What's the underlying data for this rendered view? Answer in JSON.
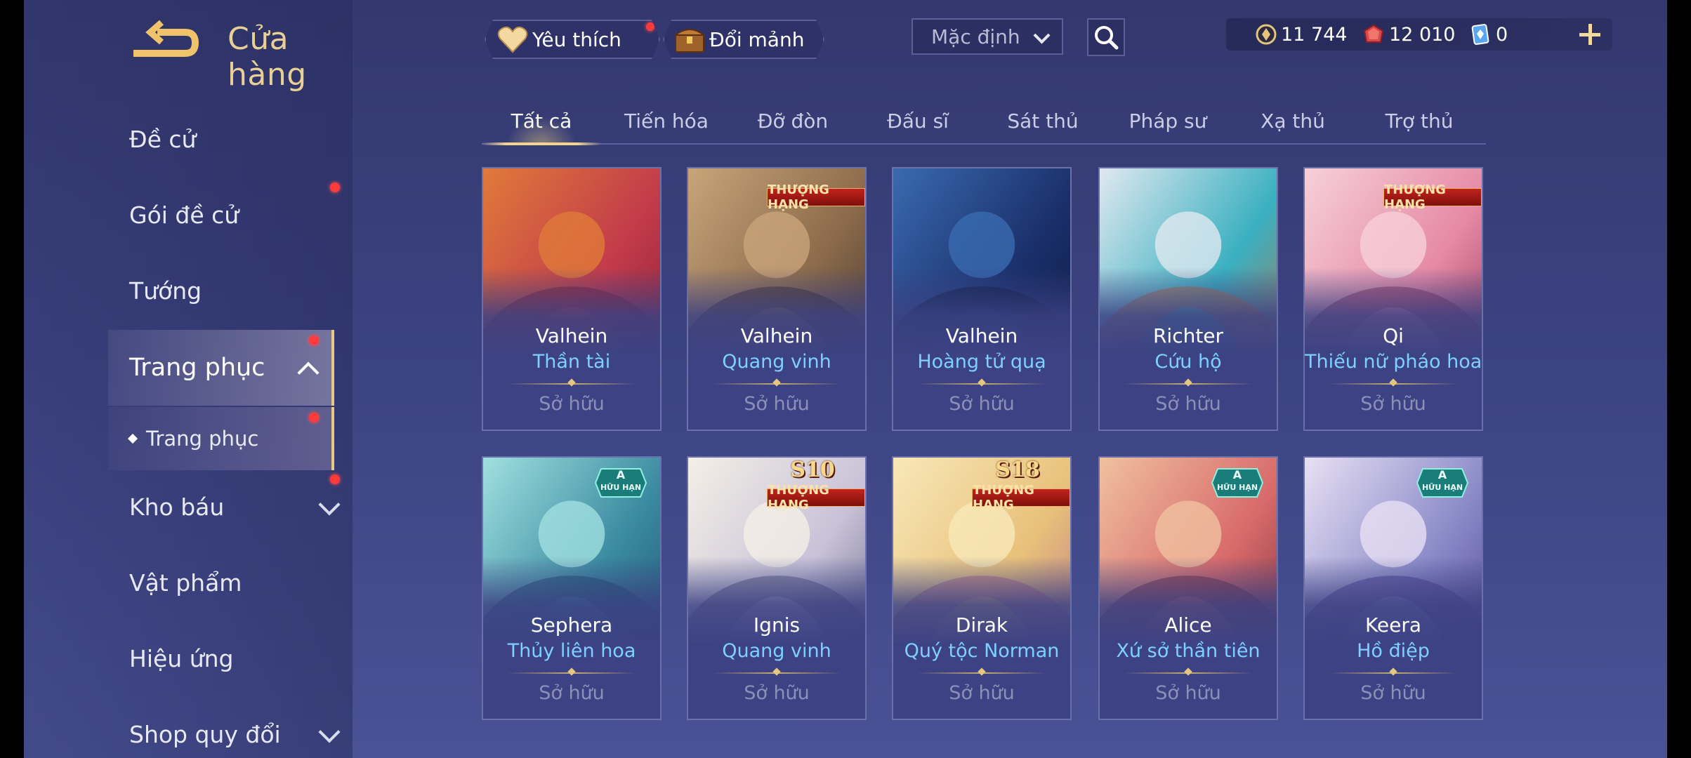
{
  "header": {
    "title": "Cửa hàng",
    "favorites_label": "Yêu thích",
    "exchange_label": "Đổi mảnh",
    "sort_value": "Mặc định"
  },
  "currency": {
    "gold": "11 744",
    "vouchers": "12 010",
    "diamonds": "0"
  },
  "sidebar": {
    "items": [
      {
        "label": "Đề cử"
      },
      {
        "label": "Gói đề cử"
      },
      {
        "label": "Tướng"
      },
      {
        "label": "Trang phục"
      },
      {
        "label": "Trang phục"
      },
      {
        "label": "Kho báu"
      },
      {
        "label": "Vật phẩm"
      },
      {
        "label": "Hiệu ứng"
      },
      {
        "label": "Shop quy đổi"
      }
    ]
  },
  "tabs": [
    "Tất cả",
    "Tiến hóa",
    "Đỡ đòn",
    "Đấu sĩ",
    "Sát thủ",
    "Pháp sư",
    "Xạ thủ",
    "Trợ thủ"
  ],
  "badges": {
    "rank": "THƯỢNG HẠNG",
    "limited_tier": "A",
    "limited": "HỮU HẠN"
  },
  "cards": [
    {
      "hero": "Valhein",
      "skin": "Thần tài",
      "status": "Sở hữu",
      "badge": "none",
      "season": ""
    },
    {
      "hero": "Valhein",
      "skin": "Quang vinh",
      "status": "Sở hữu",
      "badge": "rank",
      "season": ""
    },
    {
      "hero": "Valhein",
      "skin": "Hoàng tử quạ",
      "status": "Sở hữu",
      "badge": "none",
      "season": ""
    },
    {
      "hero": "Richter",
      "skin": "Cứu hộ",
      "status": "Sở hữu",
      "badge": "none",
      "season": ""
    },
    {
      "hero": "Qi",
      "skin": "Thiếu nữ pháo hoa",
      "status": "Sở hữu",
      "badge": "rank",
      "season": ""
    },
    {
      "hero": "Sephera",
      "skin": "Thủy liên hoa",
      "status": "Sở hữu",
      "badge": "limited",
      "season": ""
    },
    {
      "hero": "Ignis",
      "skin": "Quang vinh",
      "status": "Sở hữu",
      "badge": "rank",
      "season": "S10"
    },
    {
      "hero": "Dirak",
      "skin": "Quý tộc Norman",
      "status": "Sở hữu",
      "badge": "rank",
      "season": "S18"
    },
    {
      "hero": "Alice",
      "skin": "Xứ sở thần tiên",
      "status": "Sở hữu",
      "badge": "limited",
      "season": ""
    },
    {
      "hero": "Keera",
      "skin": "Hồ điệp",
      "status": "Sở hữu",
      "badge": "limited",
      "season": ""
    }
  ],
  "colors": {
    "accent_gold": "#e8cf95",
    "skin_name_blue": "#7fd0ff",
    "notification_red": "#ff3a3a"
  }
}
